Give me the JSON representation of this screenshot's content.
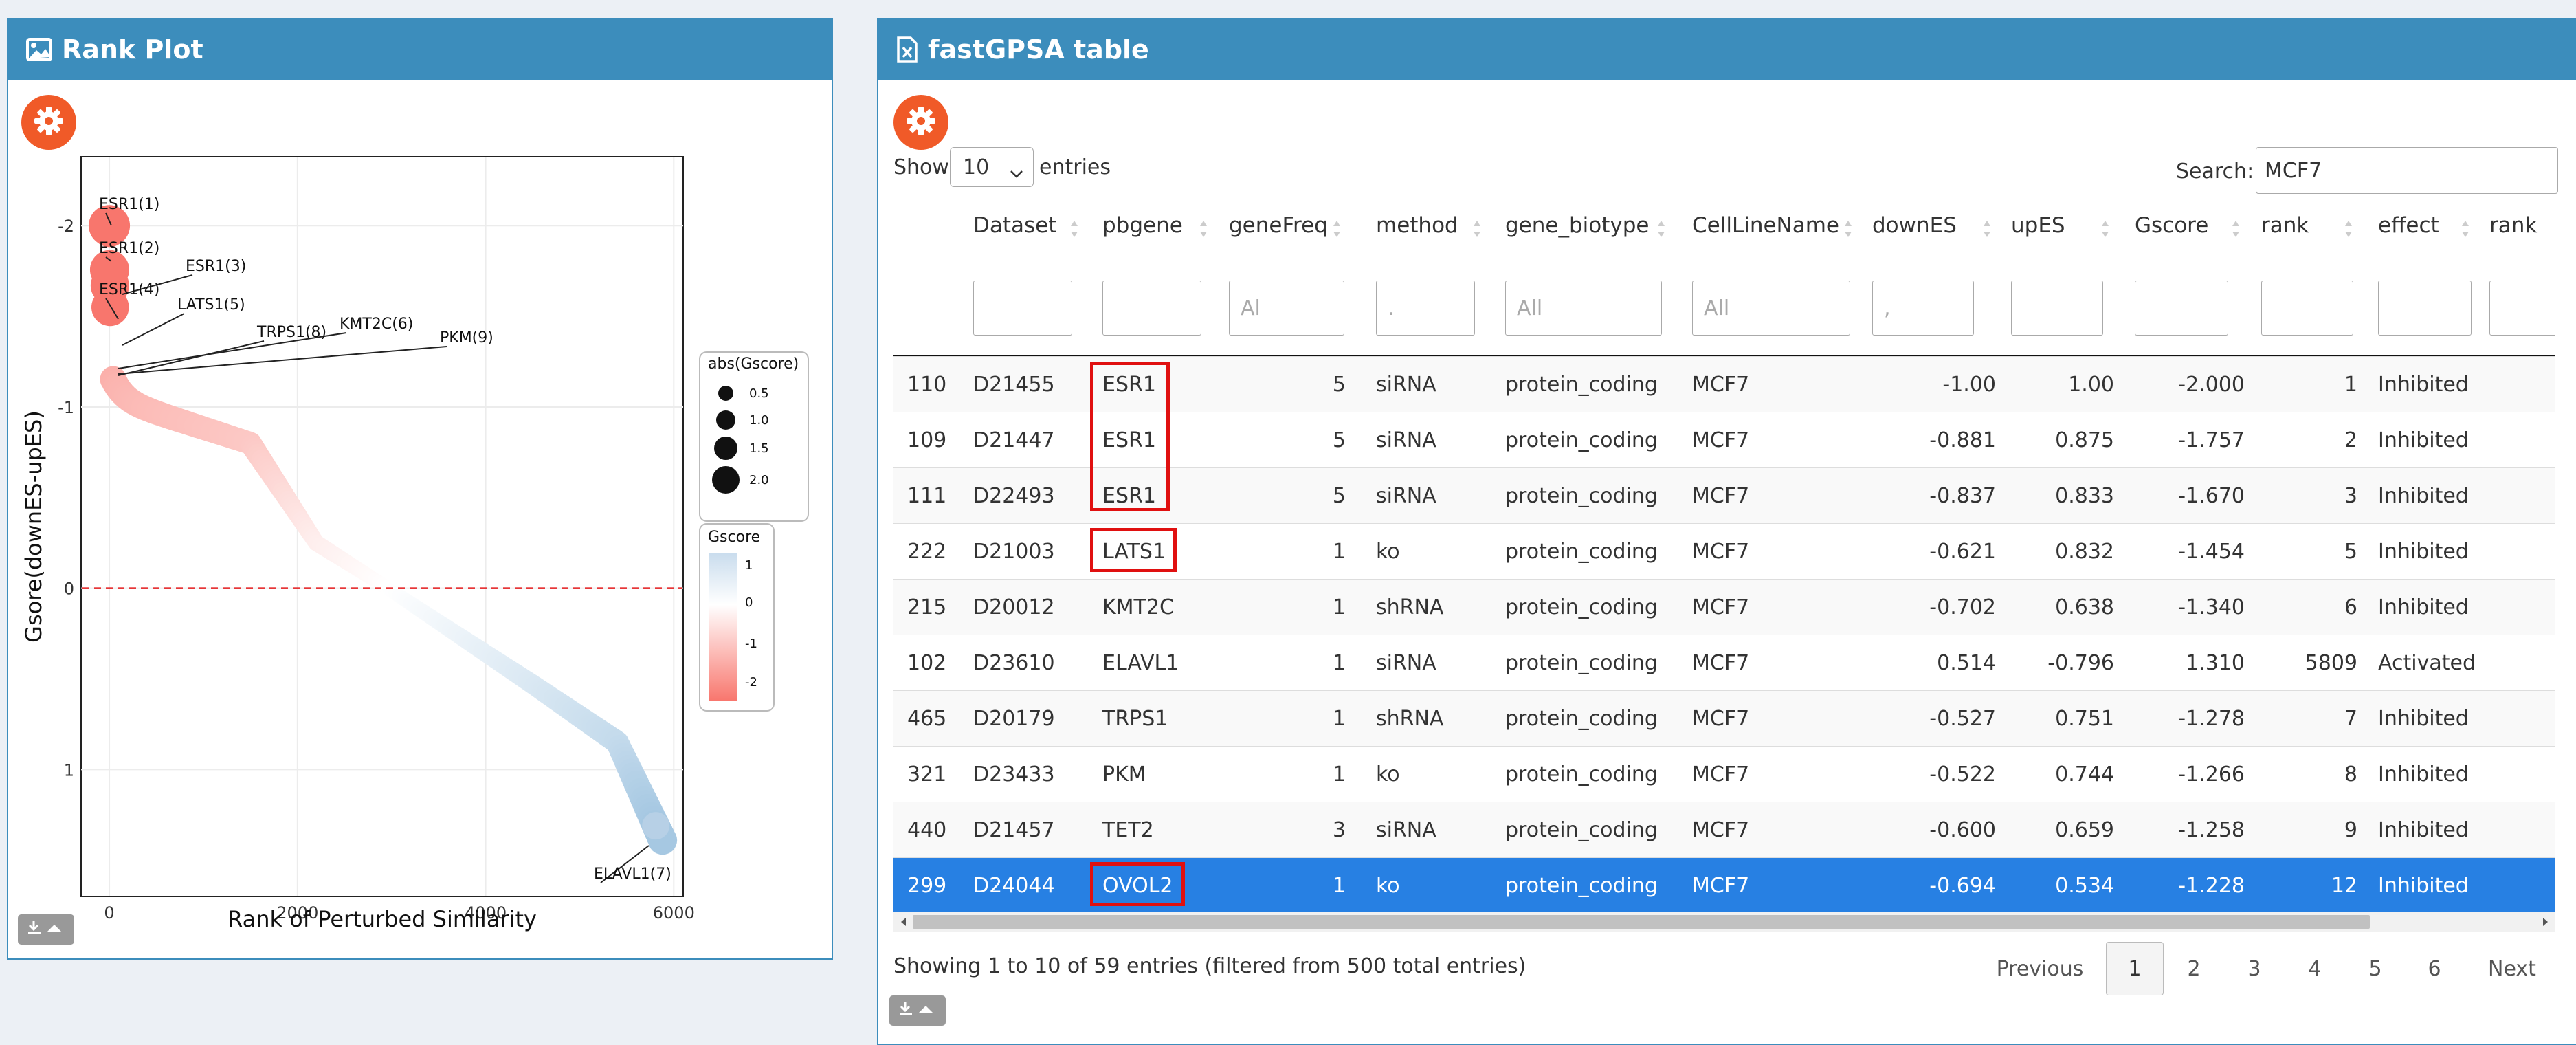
{
  "rank_plot": {
    "title": "Rank Plot",
    "chart_data": {
      "type": "scatter",
      "xlabel": "Rank of Perturbed Similarity",
      "ylabel": "Gsore(downES-upES)",
      "x_ticks": [
        "0",
        "2000",
        "4000",
        "6000"
      ],
      "y_ticks": [
        "-2",
        "-1",
        "0",
        "1"
      ],
      "xlim": [
        -300,
        6100
      ],
      "ylim_reversed": [
        -2.38,
        1.7
      ],
      "labels": [
        {
          "text": "ESR1(1)",
          "x": 1,
          "y": -2.0
        },
        {
          "text": "ESR1(2)",
          "x": 2,
          "y": -1.757
        },
        {
          "text": "ESR1(3)",
          "x": 3,
          "y": -1.67
        },
        {
          "text": "ESR1(4)",
          "x": 4,
          "y": -1.55
        },
        {
          "text": "LATS1(5)",
          "x": 5,
          "y": -1.454
        },
        {
          "text": "KMT2C(6)",
          "x": 6,
          "y": -1.34
        },
        {
          "text": "TRPS1(8)",
          "x": 7,
          "y": -1.278
        },
        {
          "text": "PKM(9)",
          "x": 8,
          "y": -1.266
        },
        {
          "text": "ELAVL1(7)",
          "x": 5809,
          "y": 1.31
        }
      ],
      "legend_size_title": "abs(Gscore)",
      "legend_size_values": [
        "0.5",
        "1.0",
        "1.5",
        "2.0"
      ],
      "legend_color_title": "Gscore",
      "legend_color_values": [
        "1",
        "0",
        "-1",
        "-2"
      ],
      "reference_line_y": 0
    }
  },
  "table_panel": {
    "title": "fastGPSA table",
    "show_label": "Show",
    "length_value": "10",
    "entries_label": "entries",
    "search_label": "Search:",
    "search_value": "MCF7",
    "columns": [
      "",
      "Dataset",
      "pbgene",
      "geneFreq",
      "method",
      "gene_biotype",
      "CellLineName",
      "downES",
      "upES",
      "Gscore",
      "rank",
      "effect",
      "rank"
    ],
    "filters": [
      "",
      "",
      "Al",
      ".",
      "All",
      "All",
      ",",
      "",
      "",
      "",
      "",
      ""
    ],
    "rows": [
      [
        "110",
        "D21455",
        "ESR1",
        "5",
        "siRNA",
        "protein_coding",
        "MCF7",
        "-1.00",
        "1.00",
        "-2.000",
        "1",
        "Inhibited"
      ],
      [
        "109",
        "D21447",
        "ESR1",
        "5",
        "siRNA",
        "protein_coding",
        "MCF7",
        "-0.881",
        "0.875",
        "-1.757",
        "2",
        "Inhibited"
      ],
      [
        "111",
        "D22493",
        "ESR1",
        "5",
        "siRNA",
        "protein_coding",
        "MCF7",
        "-0.837",
        "0.833",
        "-1.670",
        "3",
        "Inhibited"
      ],
      [
        "222",
        "D21003",
        "LATS1",
        "1",
        "ko",
        "protein_coding",
        "MCF7",
        "-0.621",
        "0.832",
        "-1.454",
        "5",
        "Inhibited"
      ],
      [
        "215",
        "D20012",
        "KMT2C",
        "1",
        "shRNA",
        "protein_coding",
        "MCF7",
        "-0.702",
        "0.638",
        "-1.340",
        "6",
        "Inhibited"
      ],
      [
        "102",
        "D23610",
        "ELAVL1",
        "1",
        "siRNA",
        "protein_coding",
        "MCF7",
        "0.514",
        "-0.796",
        "1.310",
        "5809",
        "Activated"
      ],
      [
        "465",
        "D20179",
        "TRPS1",
        "1",
        "shRNA",
        "protein_coding",
        "MCF7",
        "-0.527",
        "0.751",
        "-1.278",
        "7",
        "Inhibited"
      ],
      [
        "321",
        "D23433",
        "PKM",
        "1",
        "ko",
        "protein_coding",
        "MCF7",
        "-0.522",
        "0.744",
        "-1.266",
        "8",
        "Inhibited"
      ],
      [
        "440",
        "D21457",
        "TET2",
        "3",
        "siRNA",
        "protein_coding",
        "MCF7",
        "-0.600",
        "0.659",
        "-1.258",
        "9",
        "Inhibited"
      ],
      [
        "299",
        "D24044",
        "OVOL2",
        "1",
        "ko",
        "protein_coding",
        "MCF7",
        "-0.694",
        "0.534",
        "-1.228",
        "12",
        "Inhibited"
      ]
    ],
    "selected_row": 9,
    "info_text": "Showing 1 to 10 of 59 entries (filtered from 500 total entries)",
    "pagination": [
      "Previous",
      "1",
      "2",
      "3",
      "4",
      "5",
      "6",
      "Next"
    ],
    "current_page": "1"
  },
  "colors": {
    "header_blue": "#3c8dbc",
    "gear_orange": "#f05a28",
    "selected_row": "#2780e3",
    "highlight_red": "#e01010",
    "negative_red": "#f8766d",
    "positive_blue": "#a6c8e2"
  },
  "icons": [
    "image-icon",
    "excel-file-icon",
    "gear-icon",
    "download-icon"
  ]
}
